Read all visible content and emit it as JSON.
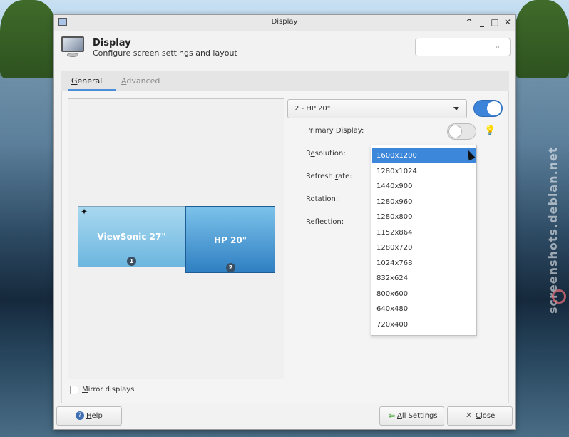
{
  "window": {
    "title": "Display",
    "controls": {
      "up": "^",
      "minimize": "_",
      "maximize": "□",
      "close": "✕"
    }
  },
  "header": {
    "title": "Display",
    "subtitle": "Configure screen settings and layout",
    "search": {
      "value": "",
      "placeholder": ""
    }
  },
  "tabs": [
    {
      "label_pre": "",
      "label_mn": "G",
      "label_post": "eneral",
      "active": true
    },
    {
      "label_pre": "",
      "label_mn": "A",
      "label_post": "dvanced",
      "active": false
    }
  ],
  "layout": {
    "monitors": [
      {
        "name": "ViewSonic 27\"",
        "number": "1",
        "primary": true
      },
      {
        "name": "HP 20\"",
        "number": "2",
        "primary": false
      }
    ],
    "primary_marker": "✦"
  },
  "display_select": {
    "value": "2 - HP 20\""
  },
  "settings": {
    "enabled": true,
    "primary_display": {
      "label": "Primary Display:",
      "on": false
    },
    "resolution": {
      "pre": "R",
      "mn": "e",
      "post": "solution:"
    },
    "refresh_rate": {
      "pre": "Refresh ",
      "mn": "r",
      "post": "ate:"
    },
    "rotation": {
      "pre": "Ro",
      "mn": "t",
      "post": "ation:"
    },
    "reflection": {
      "pre": "Re",
      "mn": "f",
      "post": "lection:"
    }
  },
  "resolution_options": [
    "1600x1200",
    "1280x1024",
    "1440x900",
    "1280x960",
    "1280x800",
    "1152x864",
    "1280x720",
    "1024x768",
    "832x624",
    "800x600",
    "640x480",
    "720x400"
  ],
  "resolution_selected": "1600x1200",
  "mirror": {
    "pre": "",
    "mn": "M",
    "post": "irror displays",
    "checked": false
  },
  "buttons": {
    "help": {
      "pre": "",
      "mn": "H",
      "post": "elp"
    },
    "all_settings": {
      "pre": "",
      "mn": "A",
      "post": "ll Settings"
    },
    "close": {
      "pre": "",
      "mn": "C",
      "post": "lose"
    }
  },
  "watermark": "screenshots.debian.net",
  "colors": {
    "accent": "#3d87da",
    "toggle_on": "#3c84d9"
  }
}
